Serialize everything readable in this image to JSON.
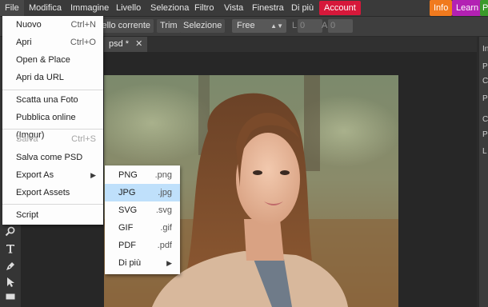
{
  "menubar": {
    "items": [
      "File",
      "Modifica",
      "Immagine",
      "Livello",
      "Seleziona",
      "Filtro",
      "Vista",
      "Finestra",
      "Di più"
    ],
    "account": "Account",
    "info": "Info",
    "learn": "Learn",
    "extra": "P"
  },
  "toolbar": {
    "partial_button": "vello corrente",
    "trim": "Trim",
    "selection": "Selezione",
    "ratio_select": "Free",
    "l_label": "L",
    "l_value": "0",
    "a_label": "A",
    "a_value": "0"
  },
  "document": {
    "tab_title": "psd *",
    "close": "✕"
  },
  "file_menu": {
    "items": [
      {
        "label": "Nuovo",
        "shortcut": "Ctrl+N"
      },
      {
        "label": "Apri",
        "shortcut": "Ctrl+O"
      },
      {
        "label": "Open & Place",
        "shortcut": ""
      },
      {
        "label": "Apri da URL",
        "shortcut": ""
      },
      {
        "label": "Scatta una Foto",
        "shortcut": ""
      },
      {
        "label": "Pubblica online (Imgur)",
        "shortcut": ""
      },
      {
        "label": "Salva",
        "shortcut": "Ctrl+S"
      },
      {
        "label": "Salva come PSD",
        "shortcut": ""
      },
      {
        "label": "Export As",
        "shortcut": ""
      },
      {
        "label": "Export Assets",
        "shortcut": ""
      },
      {
        "label": "Script",
        "shortcut": ""
      }
    ]
  },
  "export_submenu": {
    "items": [
      {
        "label": "PNG",
        "ext": ".png"
      },
      {
        "label": "JPG",
        "ext": ".jpg"
      },
      {
        "label": "SVG",
        "ext": ".svg"
      },
      {
        "label": "GIF",
        "ext": ".gif"
      },
      {
        "label": "PDF",
        "ext": ".pdf"
      },
      {
        "label": "Di più",
        "ext": ""
      }
    ]
  },
  "right_panel": {
    "labels": [
      "In",
      "P",
      "C",
      "P",
      "C",
      "P",
      "L"
    ]
  },
  "icons": {
    "submenu_arrow": "▶",
    "select_arrow": "▲▼"
  },
  "colors": {
    "account": "#d6183a",
    "info": "#f07a1e",
    "learn": "#b321b3",
    "extra": "#3b9a2a",
    "selected_item": "#bfe0fb"
  }
}
